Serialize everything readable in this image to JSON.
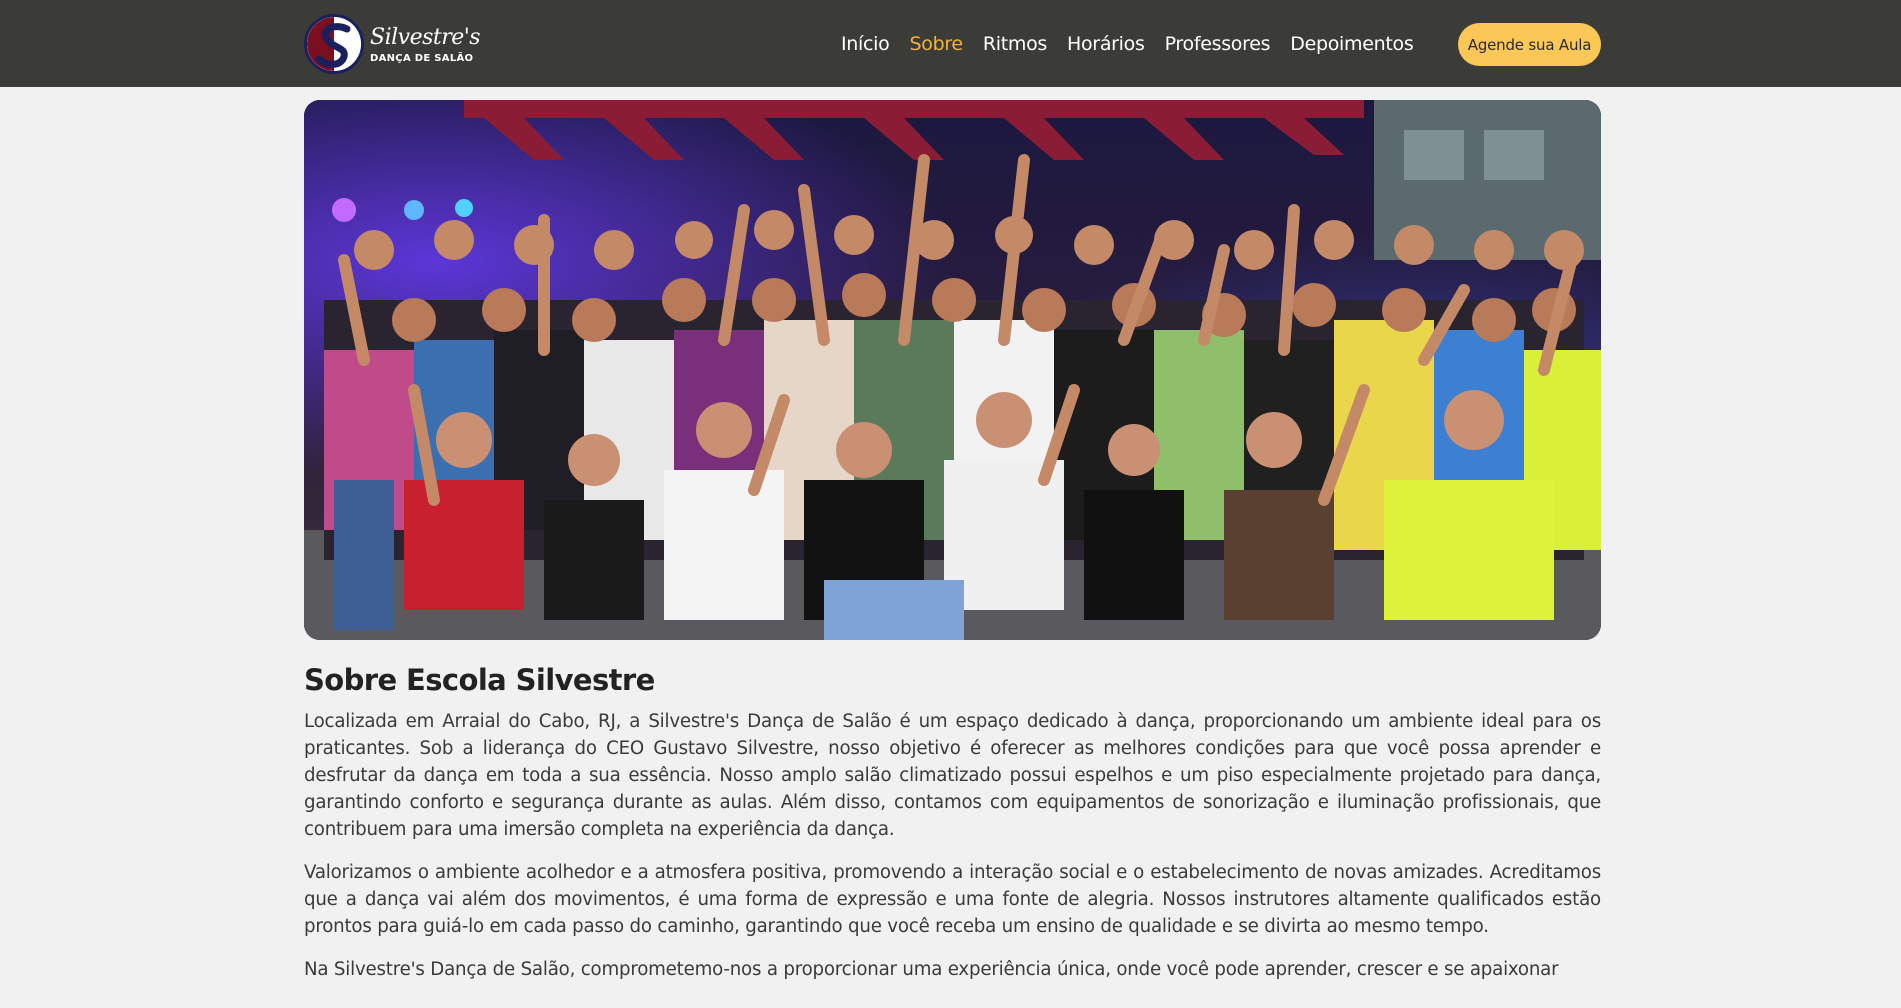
{
  "brand": {
    "script": "Silvestre's",
    "subtitle": "DANÇA DE SALÃO"
  },
  "nav": {
    "items": [
      {
        "label": "Início",
        "active": false
      },
      {
        "label": "Sobre",
        "active": true
      },
      {
        "label": "Ritmos",
        "active": false
      },
      {
        "label": "Horários",
        "active": false
      },
      {
        "label": "Professores",
        "active": false
      },
      {
        "label": "Depoimentos",
        "active": false
      }
    ],
    "cta_label": "Agende sua Aula"
  },
  "about": {
    "title": "Sobre Escola Silvestre",
    "paragraphs": [
      "Localizada em Arraial do Cabo, RJ, a Silvestre's Dança de Salão é um espaço dedicado à dança, proporcionando um ambiente ideal para os praticantes. Sob a liderança do CEO Gustavo Silvestre, nosso objetivo é oferecer as melhores condições para que você possa aprender e desfrutar da dança em toda a sua essência. Nosso amplo salão climatizado possui espelhos e um piso especialmente projetado para dança, garantindo conforto e segurança durante as aulas. Além disso, contamos com equipamentos de sonorização e iluminação profissionais, que contribuem para uma imersão completa na experiência da dança.",
      "Valorizamos o ambiente acolhedor e a atmosfera positiva, promovendo a interação social e o estabelecimento de novas amizades. Acreditamos que a dança vai além dos movimentos, é uma forma de expressão e uma fonte de alegria. Nossos instrutores altamente qualificados estão prontos para guiá-lo em cada passo do caminho, garantindo que você receba um ensino de qualidade e se divirta ao mesmo tempo.",
      "Na Silvestre's Dança de Salão, comprometemo-nos a proporcionar uma experiência única, onde você pode aprender, crescer e se apaixonar"
    ]
  },
  "colors": {
    "navbar_bg": "#3b3b38",
    "accent": "#f2b23d",
    "cta_bg": "#fbc858",
    "page_bg": "#f1f1f1"
  }
}
